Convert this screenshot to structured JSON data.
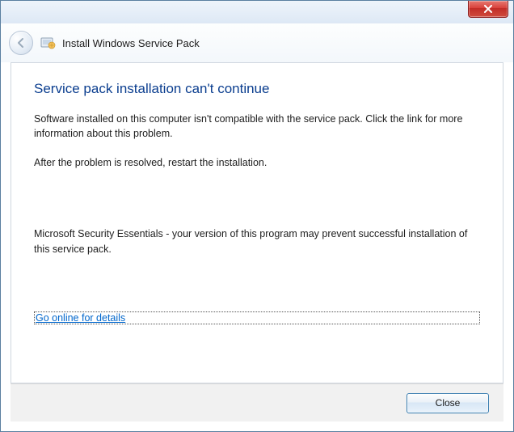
{
  "header": {
    "title": "Install Windows Service Pack"
  },
  "content": {
    "heading": "Service pack installation can't continue",
    "paragraph1": "Software installed on this computer isn't compatible with the service pack. Click the link for more information about this problem.",
    "paragraph2": "After the problem is resolved, restart the installation.",
    "paragraph3": "Microsoft Security Essentials - your version of this program may prevent successful installation of this service pack.",
    "link_label": "Go online for details"
  },
  "footer": {
    "close_label": "Close"
  }
}
